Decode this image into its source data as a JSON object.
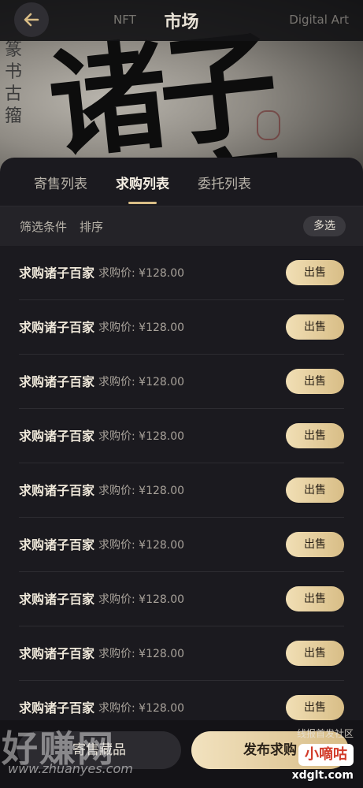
{
  "header": {
    "title": "市场",
    "left_faded": "NFT",
    "right_faded": "Digital Art"
  },
  "banner": {
    "calligraphy": "诸子百家",
    "side_text": "篆书古籀"
  },
  "tabs": [
    {
      "label": "寄售列表",
      "active": false
    },
    {
      "label": "求购列表",
      "active": true
    },
    {
      "label": "委托列表",
      "active": false
    }
  ],
  "filters": {
    "condition_label": "筛选条件",
    "sort_label": "排序",
    "multi_select_label": "多选"
  },
  "rows": [
    {
      "name": "求购诸子百家",
      "price_label": "求购价: ¥128.00",
      "action": "出售"
    },
    {
      "name": "求购诸子百家",
      "price_label": "求购价: ¥128.00",
      "action": "出售"
    },
    {
      "name": "求购诸子百家",
      "price_label": "求购价: ¥128.00",
      "action": "出售"
    },
    {
      "name": "求购诸子百家",
      "price_label": "求购价: ¥128.00",
      "action": "出售"
    },
    {
      "name": "求购诸子百家",
      "price_label": "求购价: ¥128.00",
      "action": "出售"
    },
    {
      "name": "求购诸子百家",
      "price_label": "求购价: ¥128.00",
      "action": "出售"
    },
    {
      "name": "求购诸子百家",
      "price_label": "求购价: ¥128.00",
      "action": "出售"
    },
    {
      "name": "求购诸子百家",
      "price_label": "求购价: ¥128.00",
      "action": "出售"
    },
    {
      "name": "求购诸子百家",
      "price_label": "求购价: ¥128.00",
      "action": "出售"
    }
  ],
  "bottom": {
    "left_button": "寄售藏品",
    "right_button": "发布求购"
  },
  "watermark": {
    "left_big": "好赚网",
    "left_small": "www.zhuanyes.com",
    "right_top": "线报首发社区",
    "right_badge": "小嘀咕",
    "right_bottom": "xdglt.com"
  },
  "colors": {
    "background": "#1b1a1f",
    "accent_gold": "#d8bd86",
    "text_primary": "#efe8da",
    "text_secondary": "#a8a29a"
  }
}
